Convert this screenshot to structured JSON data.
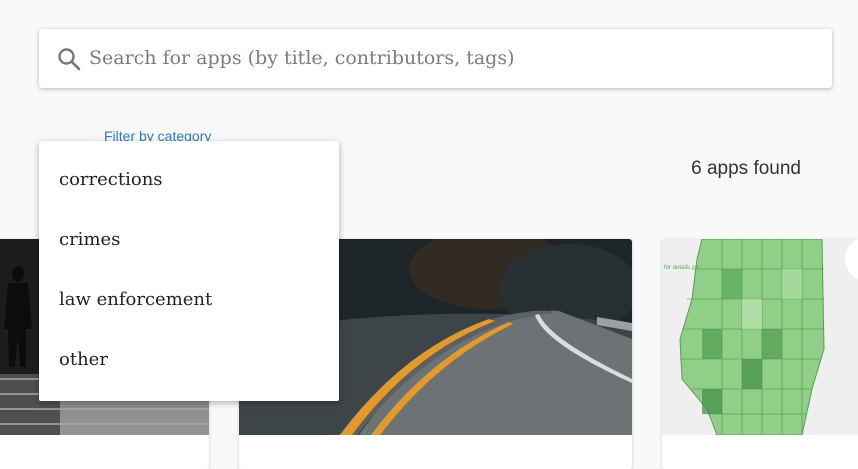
{
  "search": {
    "placeholder": "Search for apps (by title, contributors, tags)",
    "icon": "search-icon"
  },
  "filter": {
    "link_label": "Filter by category",
    "options": [
      "corrections",
      "crimes",
      "law enforcement",
      "other"
    ]
  },
  "results": {
    "count_label": "6 apps found"
  },
  "map_thumbnail": {
    "caption": "for details >>"
  },
  "colors": {
    "link": "#2a7ac7",
    "background": "#f9f9f9",
    "map_green": "#8fcf87"
  }
}
